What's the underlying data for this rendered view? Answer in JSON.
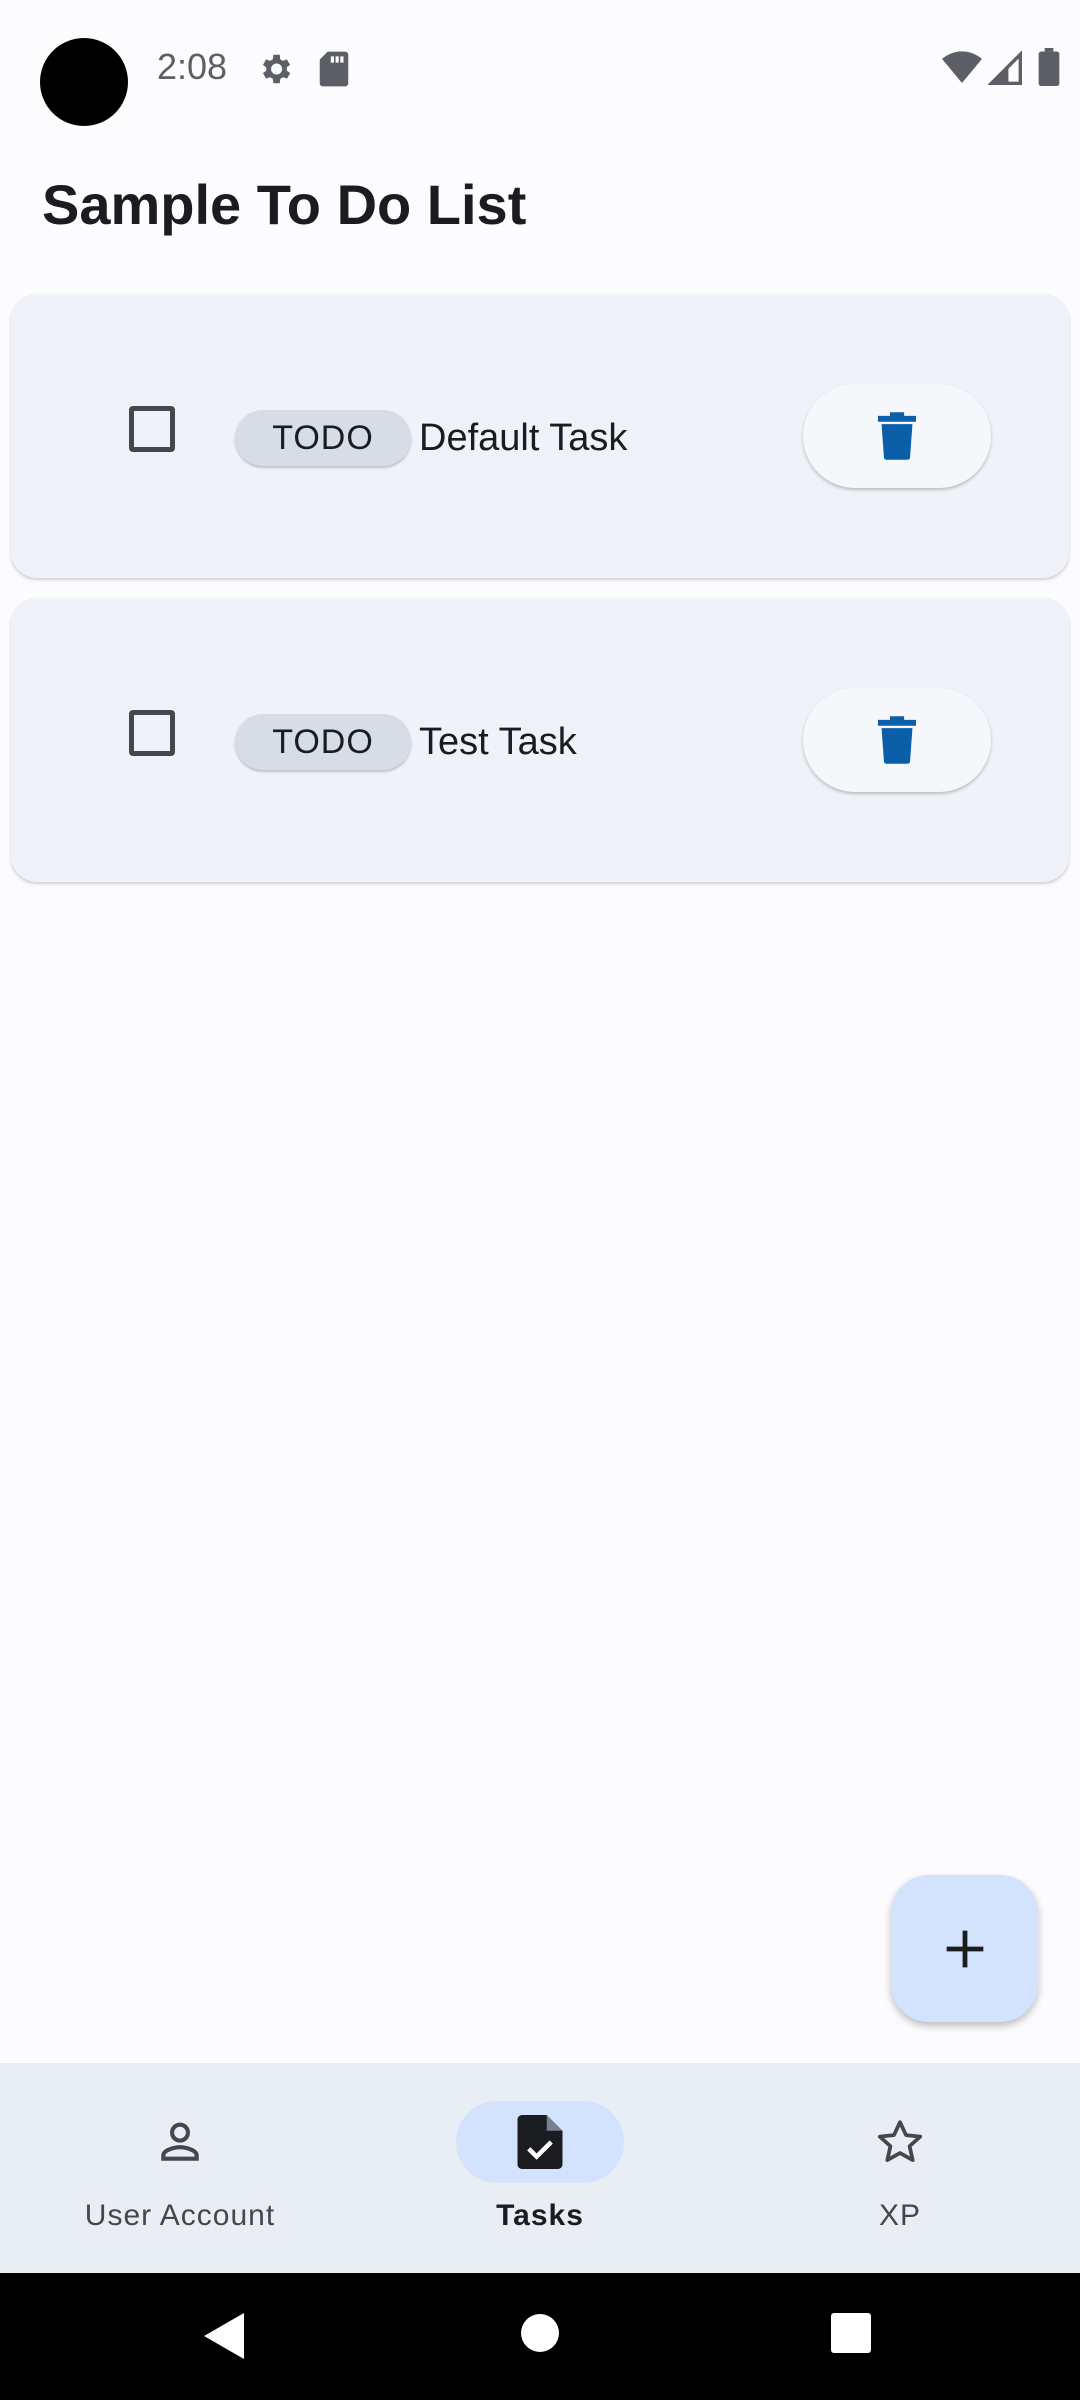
{
  "status_bar": {
    "time": "2:08",
    "icons": [
      "gear-icon",
      "sd-card-icon",
      "wifi-icon",
      "cell-signal-icon",
      "battery-icon"
    ]
  },
  "app": {
    "title": "Sample To Do List"
  },
  "tasks": [
    {
      "status": "TODO",
      "title": "Default Task",
      "checked": false
    },
    {
      "status": "TODO",
      "title": "Test Task",
      "checked": false
    }
  ],
  "fab": {
    "icon": "plus-icon"
  },
  "bottom_nav": {
    "items": [
      {
        "label": "User Account",
        "icon": "person-icon",
        "active": false
      },
      {
        "label": "Tasks",
        "icon": "task-document-icon",
        "active": true
      },
      {
        "label": "XP",
        "icon": "star-icon",
        "active": false
      }
    ]
  },
  "colors": {
    "accent": "#0b5fa8",
    "card_background": "#eff2f8",
    "chip_background": "#d6dde7",
    "fab_background": "#d3e3fd",
    "nav_background": "#e9edf4"
  }
}
